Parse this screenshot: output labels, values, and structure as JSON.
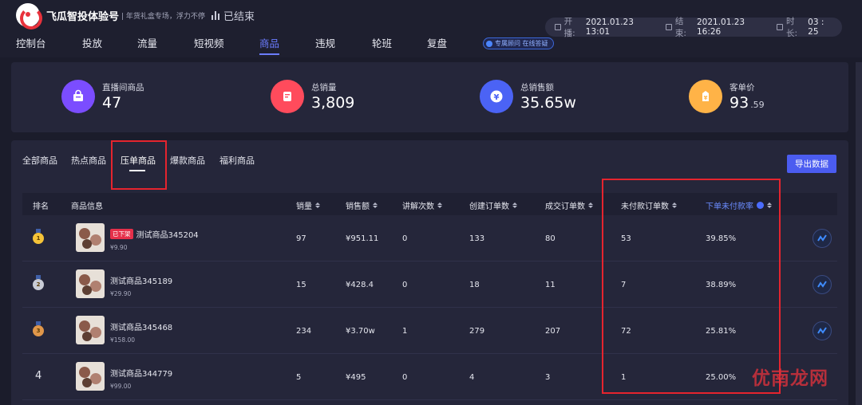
{
  "header": {
    "brand": "飞瓜智投体验号",
    "slogan": "年货礼盒专场，浮力不停",
    "status": "已结束",
    "start_label": "开播:",
    "start_value": "2021.01.23 13:01",
    "end_label": "结束:",
    "end_value": "2021.01.23 16:26",
    "duration_label": "时长:",
    "duration_value": "03 : 25"
  },
  "nav": {
    "items": [
      "控制台",
      "投放",
      "流量",
      "短视频",
      "商品",
      "违规",
      "轮班",
      "复盘"
    ],
    "active_index": 4,
    "advisor_label": "专属顾问 在线答疑"
  },
  "stats": [
    {
      "label": "直播间商品",
      "value": "47",
      "icon": "bag-icon",
      "color": "#7b4dff"
    },
    {
      "label": "总销量",
      "value": "3,809",
      "icon": "document-icon",
      "color": "#ff4b5c"
    },
    {
      "label": "总销售额",
      "value": "35.65w",
      "icon": "yen-icon",
      "color": "#4b63f5"
    },
    {
      "label": "客单价",
      "value": "93",
      "value_small": ".59",
      "icon": "price-tag-icon",
      "color": "#ffb347"
    }
  ],
  "subtabs": {
    "items": [
      "全部商品",
      "热点商品",
      "压单商品",
      "爆款商品",
      "福利商品"
    ],
    "active_index": 2,
    "export_label": "导出数据"
  },
  "table": {
    "columns": [
      "排名",
      "商品信息",
      "销量",
      "销售额",
      "讲解次数",
      "创建订单数",
      "成交订单数",
      "未付款订单数",
      "下单未付款率"
    ],
    "rows": [
      {
        "rank": "1",
        "tag": "已下架",
        "name": "测试商品345204",
        "price": "¥9.90",
        "sales": "97",
        "revenue": "¥951.11",
        "explain": "0",
        "created": "133",
        "deals": "80",
        "unpaid": "53",
        "unpaid_rate": "39.85%"
      },
      {
        "rank": "2",
        "tag": "",
        "name": "测试商品345189",
        "price": "¥29.90",
        "sales": "15",
        "revenue": "¥428.4",
        "explain": "0",
        "created": "18",
        "deals": "11",
        "unpaid": "7",
        "unpaid_rate": "38.89%"
      },
      {
        "rank": "3",
        "tag": "",
        "name": "测试商品345468",
        "price": "¥158.00",
        "sales": "234",
        "revenue": "¥3.70w",
        "explain": "1",
        "created": "279",
        "deals": "207",
        "unpaid": "72",
        "unpaid_rate": "25.81%"
      },
      {
        "rank": "4",
        "tag": "",
        "name": "测试商品344779",
        "price": "¥99.00",
        "sales": "5",
        "revenue": "¥495",
        "explain": "0",
        "created": "4",
        "deals": "3",
        "unpaid": "1",
        "unpaid_rate": "25.00%"
      }
    ]
  },
  "watermark": "优南龙网",
  "colors": {
    "accent": "#4b5cf0",
    "highlight_box": "#e5242e",
    "gold": "#f5c338",
    "silver": "#c9ccd6",
    "bronze": "#e0974a"
  }
}
